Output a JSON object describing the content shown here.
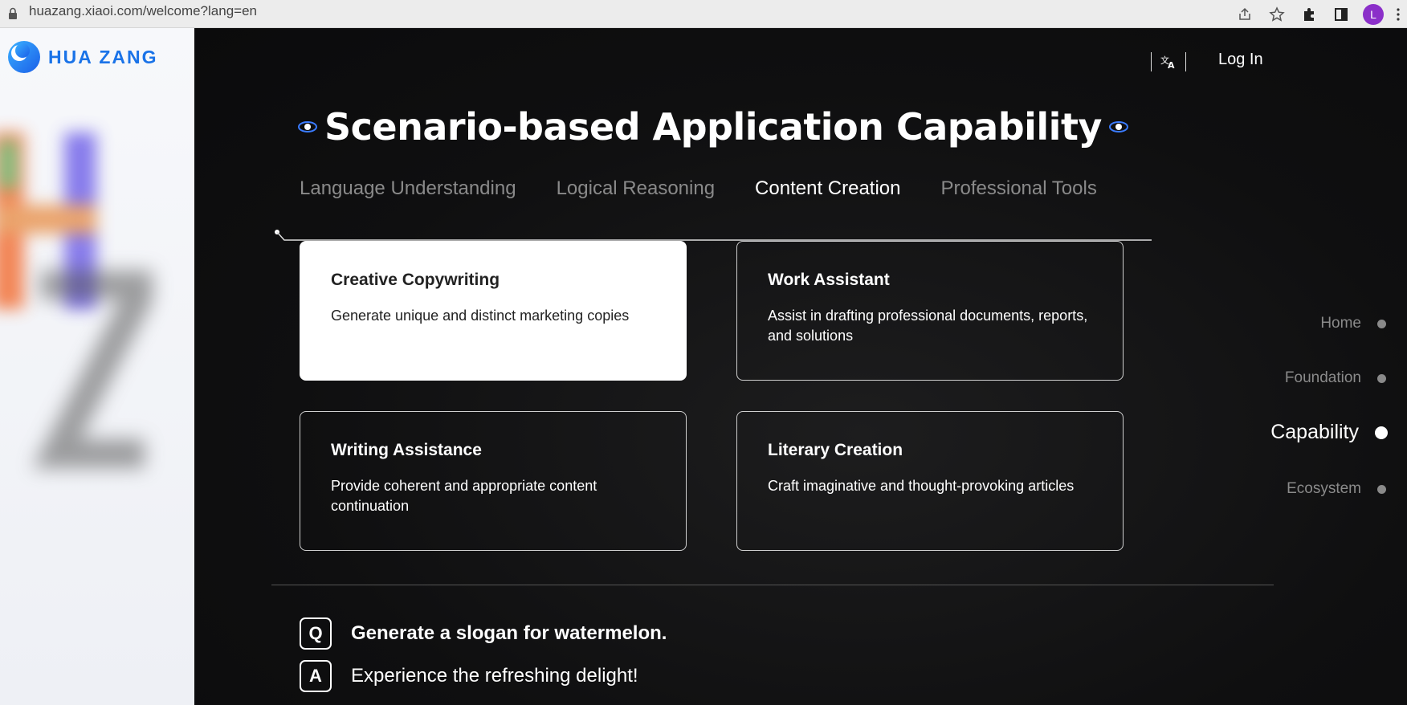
{
  "browser": {
    "url": "huazang.xiaoi.com/welcome?lang=en",
    "avatar_letter": "L"
  },
  "brand": {
    "name": "HUA ZANG",
    "accent": "#1a73e8"
  },
  "header": {
    "lang_icon": "translate-icon",
    "login_label": "Log In"
  },
  "section": {
    "title": "Scenario-based Application Capability"
  },
  "tabs": [
    {
      "label": "Language Understanding",
      "active": false
    },
    {
      "label": "Logical Reasoning",
      "active": false
    },
    {
      "label": "Content Creation",
      "active": true
    },
    {
      "label": "Professional Tools",
      "active": false
    }
  ],
  "cards": [
    {
      "title": "Creative Copywriting",
      "desc": "Generate unique and distinct marketing copies",
      "selected": true
    },
    {
      "title": "Work Assistant",
      "desc": "Assist in drafting professional documents, reports, and solutions",
      "selected": false
    },
    {
      "title": "Writing Assistance",
      "desc": "Provide coherent and appropriate content continuation",
      "selected": false
    },
    {
      "title": "Literary Creation",
      "desc": "Craft imaginative and thought-provoking articles",
      "selected": false
    }
  ],
  "qa": {
    "q_badge": "Q",
    "question": "Generate a slogan for watermelon.",
    "a_badge": "A",
    "answer": "Experience the refreshing delight!"
  },
  "side_nav": [
    {
      "label": "Home",
      "active": false
    },
    {
      "label": "Foundation",
      "active": false
    },
    {
      "label": "Capability",
      "active": true
    },
    {
      "label": "Ecosystem",
      "active": false
    }
  ]
}
